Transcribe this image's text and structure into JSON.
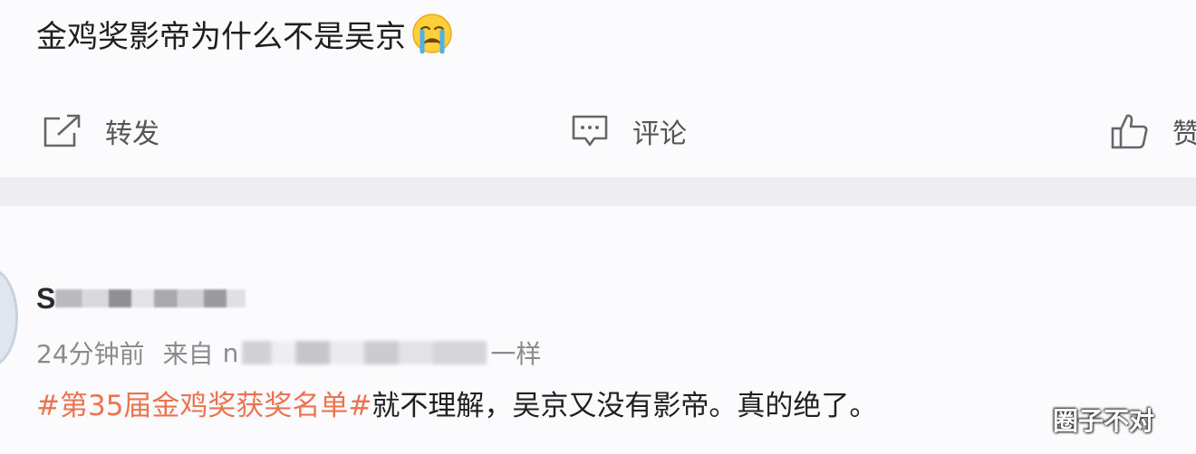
{
  "post": {
    "text": "金鸡奖影帝为什么不是吴京",
    "emoji": "crying-face-emoji"
  },
  "actions": {
    "repost_label": "转发",
    "comment_label": "评论",
    "like_label": "赞"
  },
  "comment": {
    "username_initial": "S",
    "time": "24分钟前",
    "source_prefix": "来自",
    "source_start": "n",
    "source_end": "一样",
    "hashtag": "#第35届金鸡奖获奖名单#",
    "text": "就不理解，吴京又没有影帝。真的绝了。"
  },
  "watermark": "圈子不对",
  "colors": {
    "hashtag": "#eb7350",
    "text": "#1f1f1f",
    "meta": "#8a8a8f",
    "action": "#555555",
    "separator": "#eeeef2"
  }
}
